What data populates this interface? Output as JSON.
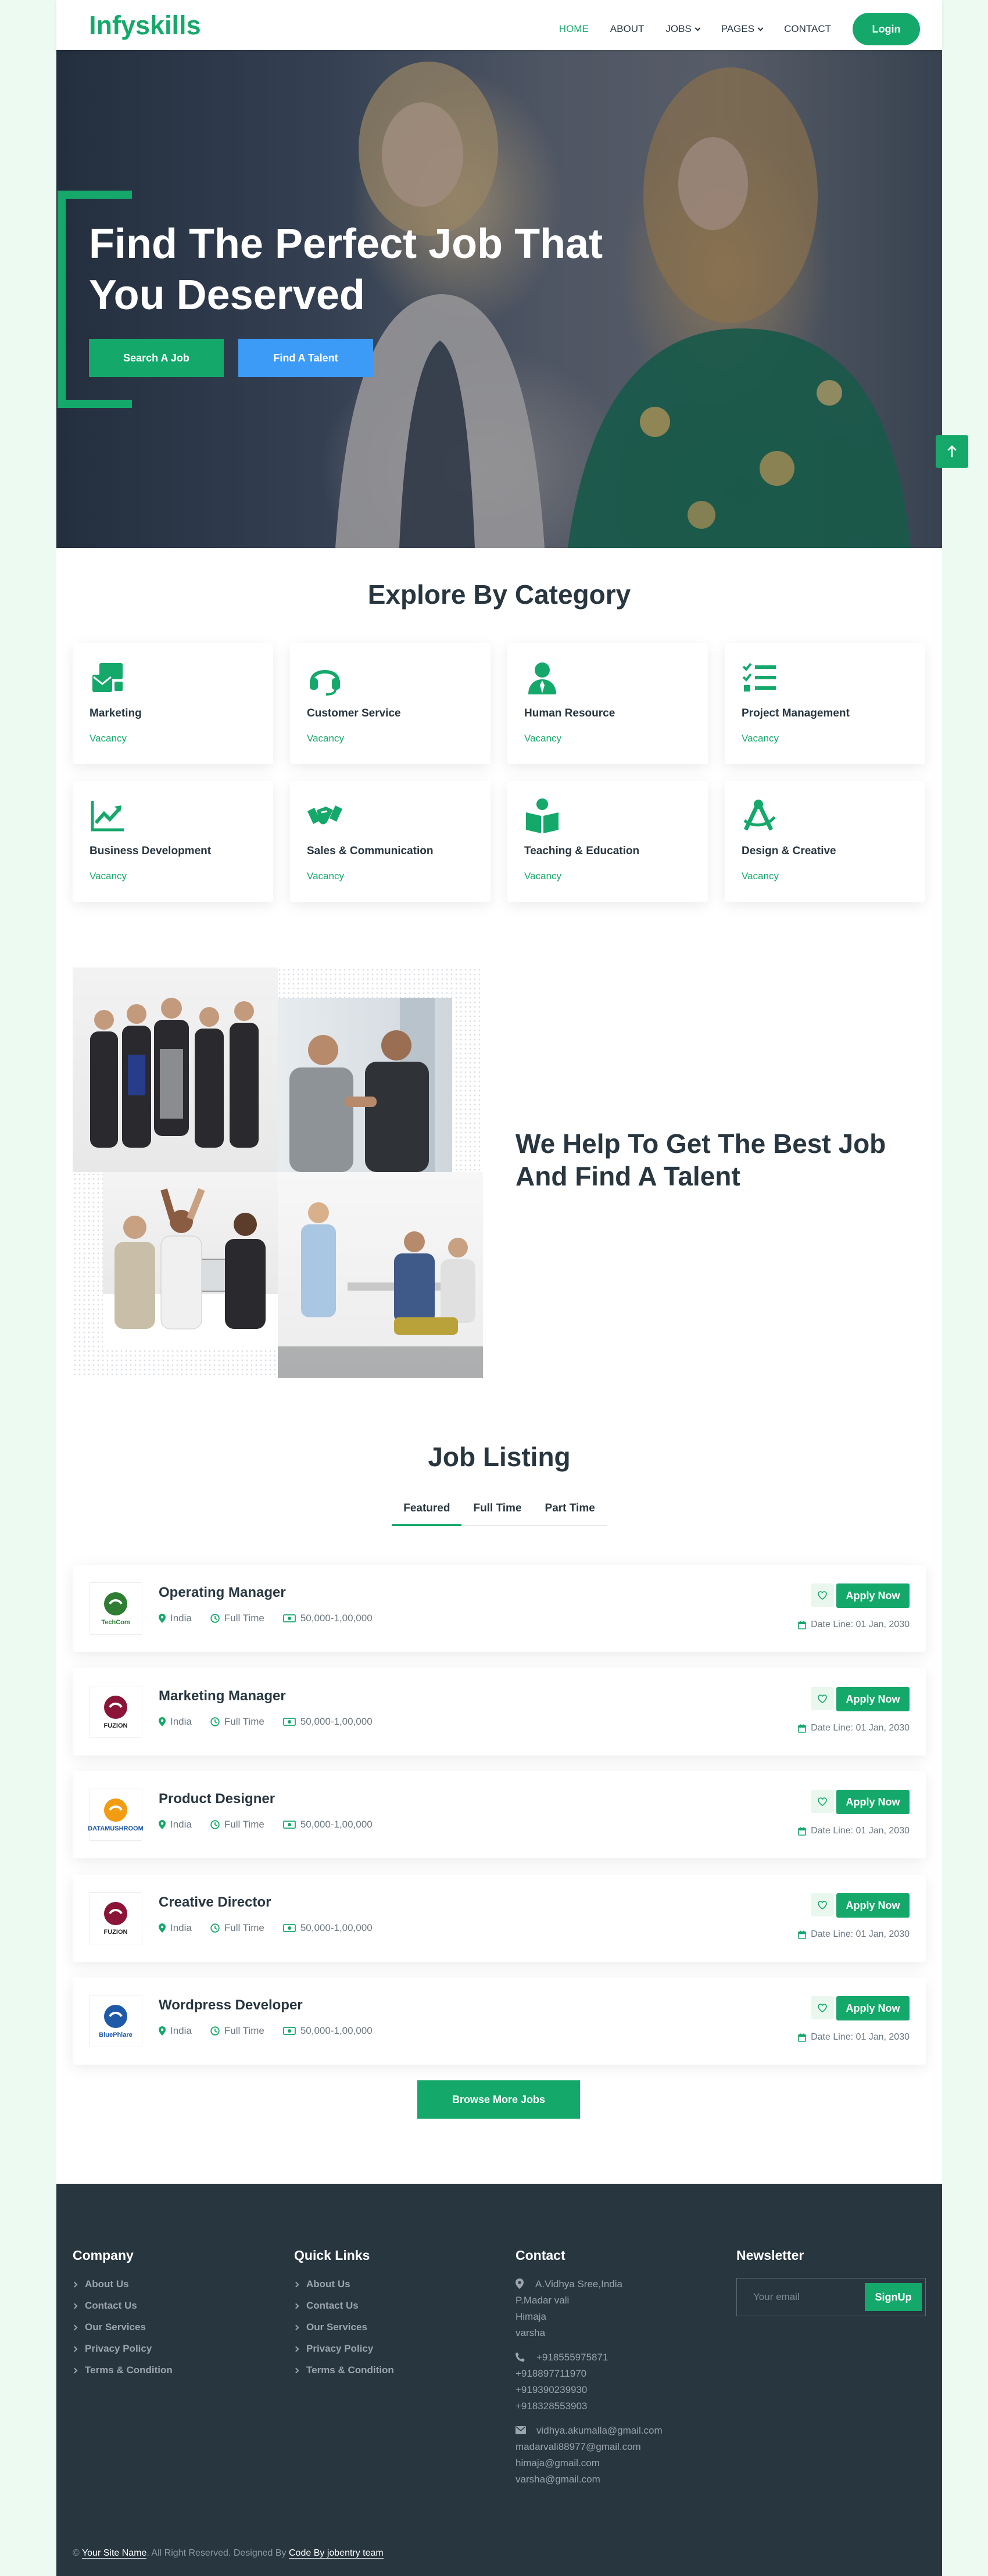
{
  "brand": "Infyskills",
  "nav": {
    "items": [
      {
        "label": "HOME",
        "active": true,
        "dropdown": false
      },
      {
        "label": "ABOUT",
        "active": false,
        "dropdown": false
      },
      {
        "label": "JOBS",
        "active": false,
        "dropdown": true
      },
      {
        "label": "PAGES",
        "active": false,
        "dropdown": true
      },
      {
        "label": "CONTACT",
        "active": false,
        "dropdown": false
      }
    ],
    "login": "Login"
  },
  "hero": {
    "title_line1": "Find The Perfect Job That",
    "title_line2": "You Deserved",
    "search_btn": "Search A Job",
    "talent_btn": "Find A Talent"
  },
  "categories": {
    "title": "Explore By Category",
    "items": [
      {
        "name": "Marketing",
        "vacancy": "Vacancy",
        "icon": "mail-bulk-icon"
      },
      {
        "name": "Customer Service",
        "vacancy": "Vacancy",
        "icon": "headset-icon"
      },
      {
        "name": "Human Resource",
        "vacancy": "Vacancy",
        "icon": "user-tie-icon"
      },
      {
        "name": "Project Management",
        "vacancy": "Vacancy",
        "icon": "tasks-icon"
      },
      {
        "name": "Business Development",
        "vacancy": "Vacancy",
        "icon": "chart-line-icon"
      },
      {
        "name": "Sales & Communication",
        "vacancy": "Vacancy",
        "icon": "handshake-icon"
      },
      {
        "name": "Teaching & Education",
        "vacancy": "Vacancy",
        "icon": "book-reader-icon"
      },
      {
        "name": "Design & Creative",
        "vacancy": "Vacancy",
        "icon": "drafting-compass-icon"
      }
    ]
  },
  "about": {
    "line1": "We Help To Get The Best Job",
    "line2": "And Find A Talent"
  },
  "jobs": {
    "title": "Job Listing",
    "tabs": [
      "Featured",
      "Full Time",
      "Part Time"
    ],
    "active_tab": "Featured",
    "apply_label": "Apply Now",
    "items": [
      {
        "title": "Operating Manager",
        "location": "India",
        "type": "Full Time",
        "salary": "50,000-1,00,000",
        "deadline": "Date Line: 01 Jan, 2030",
        "company_logo_text": "TechCom"
      },
      {
        "title": "Marketing Manager",
        "location": "India",
        "type": "Full Time",
        "salary": "50,000-1,00,000",
        "deadline": "Date Line: 01 Jan, 2030",
        "company_logo_text": "FUZION"
      },
      {
        "title": "Product Designer",
        "location": "India",
        "type": "Full Time",
        "salary": "50,000-1,00,000",
        "deadline": "Date Line: 01 Jan, 2030",
        "company_logo_text": "DATAMUSHROOM"
      },
      {
        "title": "Creative Director",
        "location": "India",
        "type": "Full Time",
        "salary": "50,000-1,00,000",
        "deadline": "Date Line: 01 Jan, 2030",
        "company_logo_text": "FUZION"
      },
      {
        "title": "Wordpress Developer",
        "location": "India",
        "type": "Full Time",
        "salary": "50,000-1,00,000",
        "deadline": "Date Line: 01 Jan, 2030",
        "company_logo_text": "BluePhlare"
      }
    ],
    "browse_more": "Browse More Jobs"
  },
  "footer": {
    "company": {
      "title": "Company",
      "links": [
        "About Us",
        "Contact Us",
        "Our Services",
        "Privacy Policy",
        "Terms & Condition"
      ]
    },
    "quick_links": {
      "title": "Quick Links",
      "links": [
        "About Us",
        "Contact Us",
        "Our Services",
        "Privacy Policy",
        "Terms & Condition"
      ]
    },
    "contact": {
      "title": "Contact",
      "address": [
        "A.Vidhya Sree,India",
        "P.Madar vali",
        "Himaja",
        "varsha"
      ],
      "phones": [
        "+918555975871",
        "+918897711970",
        "+919390239930",
        "+918328553903"
      ],
      "emails": [
        "vidhya.akumalla@gmail.com",
        "madarvali88977@gmail.com",
        "himaja@gmail.com",
        "varsha@gmail.com"
      ]
    },
    "newsletter": {
      "title": "Newsletter",
      "placeholder": "Your email",
      "button": "SignUp"
    },
    "copyright": {
      "prefix": "©",
      "site": "Your Site Name",
      "middle": ". All Right Reserved. Designed By",
      "designer": "Code By jobentry team"
    }
  },
  "colors": {
    "accent": "#15a86b",
    "blue": "#3d9bf8",
    "dark": "#283640",
    "page_bg": "#ecfaf1"
  }
}
